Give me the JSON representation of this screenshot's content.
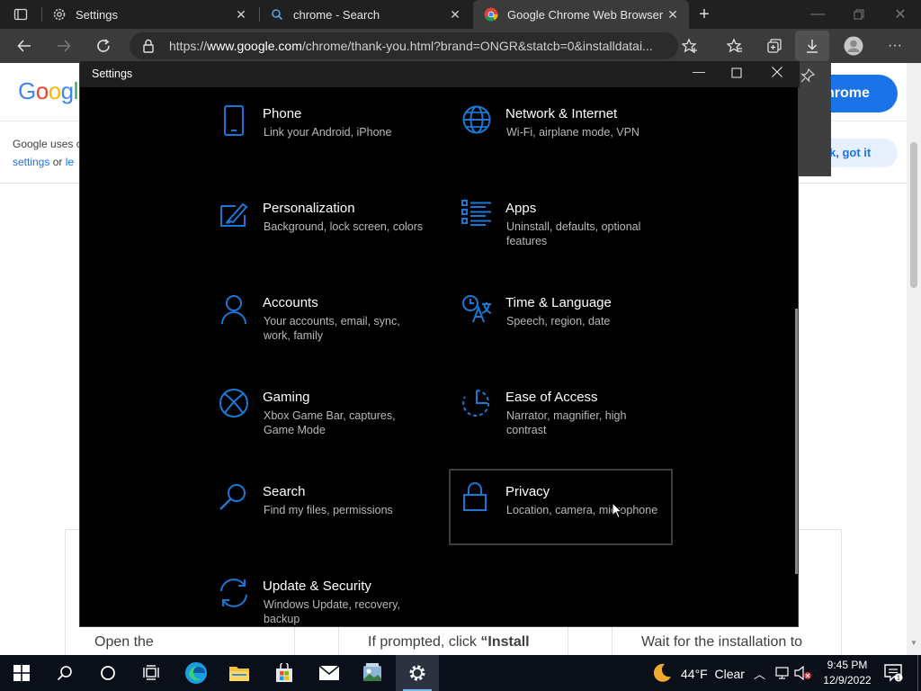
{
  "browser": {
    "tabs": [
      {
        "title": "Settings",
        "icon": "gear-icon"
      },
      {
        "title": "chrome - Search",
        "icon": "search-icon"
      },
      {
        "title": "Google Chrome Web Browser",
        "icon": "chrome-logo-icon"
      }
    ],
    "address": {
      "prefix": "https://",
      "host": "www.google.com",
      "path": "/chrome/thank-you.html?brand=ONGR&statcb=0&installdatai..."
    }
  },
  "page": {
    "google_logo": "Googl",
    "cookie_text_1": "Google uses c",
    "cookie_link_settings": "settings",
    "cookie_or": "or",
    "cookie_link_le": "le",
    "chrome_button": "hrome",
    "ok_button": "k, got it",
    "steps": [
      {
        "text": "Open the"
      },
      {
        "text": "If prompted, click ",
        "bold": "“Install"
      },
      {
        "text": "Wait for the installation to"
      }
    ]
  },
  "settings": {
    "title": "Settings",
    "items": [
      {
        "title": "Phone",
        "desc": "Link your Android, iPhone",
        "icon": "phone-icon"
      },
      {
        "title": "Network & Internet",
        "desc": "Wi-Fi, airplane mode, VPN",
        "icon": "globe-icon"
      },
      {
        "title": "Personalization",
        "desc": "Background, lock screen, colors",
        "icon": "personalization-icon"
      },
      {
        "title": "Apps",
        "desc": "Uninstall, defaults, optional features",
        "icon": "apps-list-icon"
      },
      {
        "title": "Accounts",
        "desc": "Your accounts, email, sync, work, family",
        "icon": "person-icon"
      },
      {
        "title": "Time & Language",
        "desc": "Speech, region, date",
        "icon": "time-language-icon"
      },
      {
        "title": "Gaming",
        "desc": "Xbox Game Bar, captures, Game Mode",
        "icon": "xbox-icon"
      },
      {
        "title": "Ease of Access",
        "desc": "Narrator, magnifier, high contrast",
        "icon": "ease-of-access-icon"
      },
      {
        "title": "Search",
        "desc": "Find my files, permissions",
        "icon": "search-icon"
      },
      {
        "title": "Privacy",
        "desc": "Location, camera, microphone",
        "icon": "lock-icon"
      },
      {
        "title": "Update & Security",
        "desc": "Windows Update, recovery, backup",
        "icon": "sync-icon"
      }
    ]
  },
  "taskbar": {
    "weather": "44°F  Clear",
    "time": "9:45 PM",
    "date": "12/9/2022",
    "apps": [
      "start-icon",
      "search-icon",
      "cortana-icon",
      "task-view-icon",
      "edge-icon",
      "file-explorer-icon",
      "store-icon",
      "mail-icon",
      "photos-icon",
      "settings-icon"
    ]
  },
  "colors": {
    "accent": "#1a78d4",
    "chrome_button": "#1a73e8"
  }
}
